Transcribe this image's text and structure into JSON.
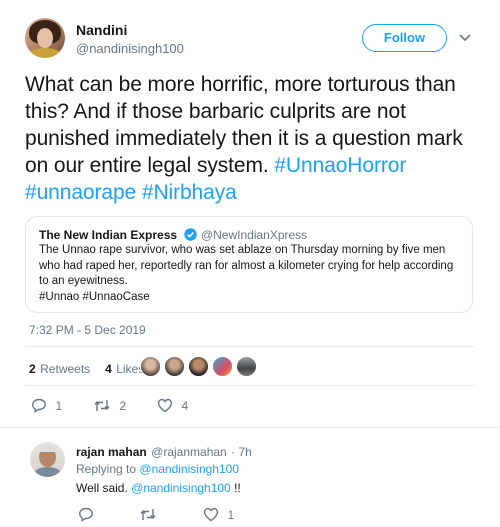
{
  "tweet": {
    "author_name": "Nandini",
    "author_handle": "@nandinisingh100",
    "follow_label": "Follow",
    "text_main": "What can be more horrific, more torturous than this? And if those barbaric culprits are not punished immediately then it is a question mark on our entire legal system.",
    "hashtags": [
      "#UnnaoHorror",
      "#unnaorape",
      "#Nirbhaya"
    ],
    "timestamp": "7:32 PM - 5 Dec 2019",
    "retweets_count": "2",
    "retweets_label": "Retweets",
    "likes_count": "4",
    "likes_label": "Likes",
    "actions": {
      "reply_count": "1",
      "retweet_count": "2",
      "like_count": "4"
    }
  },
  "quote": {
    "name": "The New Indian Express",
    "handle": "@NewIndianXpress",
    "text": "The Unnao rape survivor, who was set ablaze on Thursday morning by five men who had raped her, reportedly ran for almost a kilometer crying for help according to an eyewitness.",
    "tags": "#Unnao #UnnaoCase"
  },
  "reply": {
    "name": "rajan mahan",
    "handle": "@rajanmahan",
    "time": "· 7h",
    "replying_prefix": "Replying to",
    "replying_to": "@nandinisingh100",
    "body_prefix": "Well said.",
    "body_mention": "@nandinisingh100",
    "body_suffix": "!!",
    "actions": {
      "reply_count": "",
      "retweet_count": "",
      "like_count": "1"
    }
  },
  "colors": {
    "accent": "#1da1f2",
    "muted": "#657786",
    "text": "#14171a",
    "border": "#e1e8ed"
  }
}
